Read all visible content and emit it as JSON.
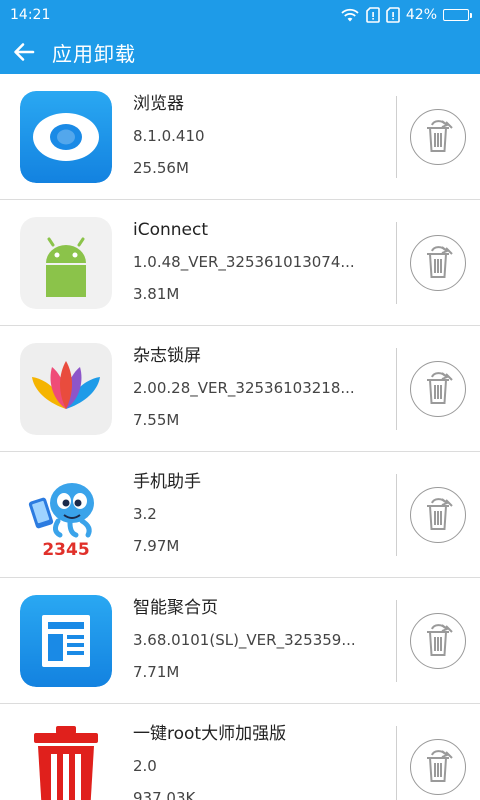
{
  "status_bar": {
    "time": "14:21",
    "battery_percent": "42%",
    "battery_level": 0.42,
    "icons": [
      "wifi-icon",
      "sim1-icon",
      "sim2-icon",
      "battery-icon"
    ]
  },
  "app_bar": {
    "title": "应用卸载",
    "back_icon": "arrow-left-icon"
  },
  "colors": {
    "primary": "#1e9be8",
    "text_primary": "#222222",
    "text_secondary": "#444444",
    "divider": "#dcdcdc",
    "button_outline": "#9a9a9a"
  },
  "apps": [
    {
      "name": "浏览器",
      "version": "8.1.0.410",
      "size": "25.56M",
      "icon": "browser-icon"
    },
    {
      "name": "iConnect",
      "version": "1.0.48_VER_325361013074...",
      "size": "3.81M",
      "icon": "android-icon"
    },
    {
      "name": "杂志锁屏",
      "version": "2.00.28_VER_32536103218...",
      "size": "7.55M",
      "icon": "lotus-icon"
    },
    {
      "name": "手机助手",
      "version": "3.2",
      "size": "7.97M",
      "icon": "octopus-2345-icon"
    },
    {
      "name": "智能聚合页",
      "version": "3.68.0101(SL)_VER_325359...",
      "size": "7.71M",
      "icon": "news-page-icon"
    },
    {
      "name": "一键root大师加强版",
      "version": "2.0",
      "size": "937.03K",
      "icon": "red-trash-icon"
    }
  ],
  "uninstall_icon": "trash-uninstall-icon",
  "icon_2345_label": "2345"
}
